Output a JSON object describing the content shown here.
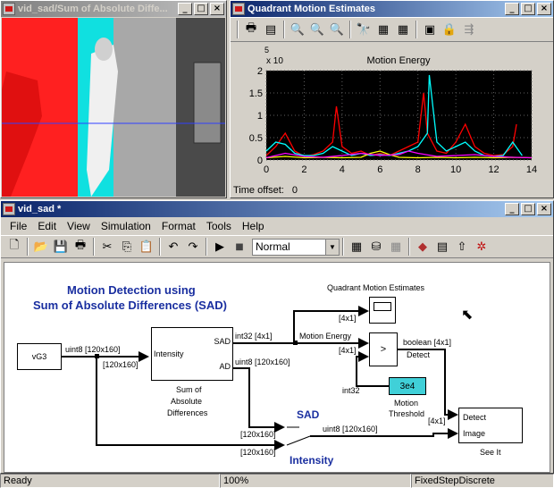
{
  "video_window": {
    "title": "vid_sad/Sum of Absolute Diffe..."
  },
  "scope_window": {
    "title": "Quadrant Motion Estimates",
    "plot_title": "Motion Energy",
    "exponent": "5",
    "exponent_prefix": "x 10",
    "y_ticks": [
      "2",
      "1.5",
      "1",
      "0.5",
      "0"
    ],
    "x_ticks": [
      "0",
      "2",
      "4",
      "6",
      "8",
      "10",
      "12",
      "14"
    ],
    "time_offset_label": "Time offset:",
    "time_offset_value": "0"
  },
  "chart_data": {
    "type": "line",
    "title": "Motion Energy",
    "xlim": [
      0,
      14
    ],
    "ylim": [
      0,
      200000
    ],
    "series": [
      {
        "color": "#ff0000",
        "x": [
          0,
          0.5,
          1,
          1.5,
          2,
          2.5,
          3,
          3.5,
          3.7,
          4,
          4.5,
          5,
          5.5,
          6,
          6.5,
          7,
          7.5,
          8,
          8.3,
          8.5,
          9,
          9.5,
          10,
          10.5,
          11,
          11.5,
          12,
          12.5,
          13,
          13.2
        ],
        "y": [
          10000,
          30000,
          60000,
          20000,
          8000,
          12000,
          20000,
          40000,
          120000,
          30000,
          15000,
          20000,
          10000,
          15000,
          10000,
          20000,
          30000,
          40000,
          150000,
          60000,
          20000,
          15000,
          40000,
          80000,
          30000,
          15000,
          10000,
          12000,
          30000,
          80000
        ]
      },
      {
        "color": "#00ffff",
        "x": [
          0,
          0.5,
          1,
          1.5,
          2,
          2.5,
          3,
          3.5,
          4,
          4.5,
          5,
          5.5,
          6,
          6.5,
          7,
          7.5,
          8,
          8.5,
          8.6,
          9,
          9.5,
          10,
          10.5,
          11,
          11.5,
          12,
          12.5,
          13,
          13.5
        ],
        "y": [
          20000,
          40000,
          35000,
          15000,
          10000,
          10000,
          15000,
          30000,
          20000,
          10000,
          15000,
          10000,
          12000,
          10000,
          15000,
          20000,
          30000,
          60000,
          190000,
          40000,
          20000,
          30000,
          40000,
          20000,
          10000,
          8000,
          10000,
          40000,
          10000
        ]
      },
      {
        "color": "#ffff00",
        "x": [
          0,
          1,
          2,
          3,
          4,
          5,
          5.5,
          6,
          6.5,
          7,
          8,
          9,
          10,
          11,
          12,
          13,
          14
        ],
        "y": [
          5000,
          8000,
          5000,
          6000,
          5000,
          6000,
          15000,
          20000,
          12000,
          6000,
          5000,
          6000,
          5000,
          6000,
          5000,
          6000,
          5000
        ]
      },
      {
        "color": "#ff00ff",
        "x": [
          0,
          1,
          2,
          3,
          4,
          5,
          6,
          7,
          7.5,
          8,
          9,
          10,
          11,
          12,
          13,
          14
        ],
        "y": [
          5000,
          15000,
          8000,
          6000,
          10000,
          15000,
          10000,
          12000,
          20000,
          15000,
          8000,
          10000,
          12000,
          8000,
          6000,
          5000
        ]
      }
    ]
  },
  "model_window": {
    "title": "vid_sad *",
    "menu": [
      "File",
      "Edit",
      "View",
      "Simulation",
      "Format",
      "Tools",
      "Help"
    ],
    "sim_mode": "Normal",
    "heading_line1": "Motion Detection using",
    "heading_line2": "Sum of Absolute Differences (SAD)",
    "source_block": "vG3",
    "sad_block_in": "Intensity",
    "sad_block_out1": "SAD",
    "sad_block_out2": "AD",
    "sad_caption_1": "Sum of",
    "sad_caption_2": "Absolute",
    "sad_caption_3": "Differences",
    "scope_caption": "Quadrant Motion Estimates",
    "compare_symbol": ">",
    "threshold_value": "3e4",
    "threshold_caption_1": "Motion",
    "threshold_caption_2": "Threshold",
    "threshold_type": "int32",
    "detect_in1": "Detect",
    "detect_in2": "Image",
    "detect_caption": "See It",
    "sig_uint8_120x160": "uint8 [120x160]",
    "sig_120x160": "[120x160]",
    "sig_int32_4x1": "int32 [4x1]",
    "sig_4x1": "[4x1]",
    "sig_motion_energy": "Motion Energy",
    "sig_uint8_120x160_b": "uint8 [120x160]",
    "sig_boolean_4x1": "boolean [4x1]",
    "sig_detect": "Detect",
    "sig_120x160_switch1": "[120x160]",
    "sig_120x160_switch2": "[120x160]",
    "sig_uint8_out": "uint8 [120x160]",
    "sig_4x1_detect": "[4x1]",
    "switch_sad_label": "SAD",
    "switch_intensity_label": "Intensity"
  },
  "status": {
    "ready": "Ready",
    "zoom": "100%",
    "solver": "FixedStepDiscrete"
  },
  "colors": {
    "accent": "#0a246a",
    "label_blue": "#1a2fa0",
    "threshold_block": "#40d0d8"
  }
}
